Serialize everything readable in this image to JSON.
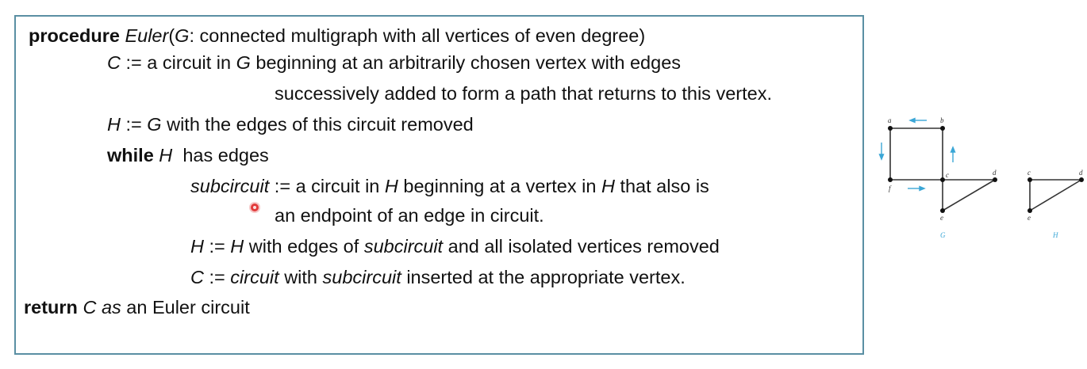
{
  "algorithm": {
    "lines": [
      {
        "segments": [
          {
            "t": "procedure ",
            "s": "b"
          },
          {
            "t": "Euler",
            "s": "i"
          },
          {
            "t": "(",
            "s": ""
          },
          {
            "t": "G",
            "s": "i"
          },
          {
            "t": ": connected multigraph with all vertices of even degree)",
            "s": ""
          }
        ]
      },
      {
        "segments": [
          {
            "t": "C",
            "s": "i"
          },
          {
            "t": " := a circuit in ",
            "s": ""
          },
          {
            "t": "G",
            "s": "i"
          },
          {
            "t": " beginning at an arbitrarily chosen vertex with edges",
            "s": ""
          }
        ]
      },
      {
        "segments": [
          {
            "t": "successively added to form a path that returns to this vertex.",
            "s": ""
          }
        ]
      },
      {
        "segments": [
          {
            "t": "H",
            "s": "i"
          },
          {
            "t": " := ",
            "s": ""
          },
          {
            "t": "G",
            "s": "i"
          },
          {
            "t": " with the edges of this circuit removed",
            "s": ""
          }
        ]
      },
      {
        "segments": [
          {
            "t": "while ",
            "s": "b"
          },
          {
            "t": "H",
            "s": "i"
          },
          {
            "t": "  has edges",
            "s": ""
          }
        ]
      },
      {
        "segments": [
          {
            "t": "subcircuit",
            "s": "i"
          },
          {
            "t": " := a circuit in ",
            "s": ""
          },
          {
            "t": "H",
            "s": "i"
          },
          {
            "t": " beginning at a vertex in ",
            "s": ""
          },
          {
            "t": "H",
            "s": "i"
          },
          {
            "t": " that also is",
            "s": ""
          }
        ]
      },
      {
        "segments": [
          {
            "t": "an endpoint of an edge in circuit.",
            "s": ""
          }
        ]
      },
      {
        "segments": [
          {
            "t": "H",
            "s": "i"
          },
          {
            "t": " := ",
            "s": ""
          },
          {
            "t": "H",
            "s": "i"
          },
          {
            "t": " with edges of ",
            "s": ""
          },
          {
            "t": "subcircuit",
            "s": "i"
          },
          {
            "t": " and all isolated vertices removed",
            "s": ""
          }
        ]
      },
      {
        "segments": [
          {
            "t": "C",
            "s": "i"
          },
          {
            "t": " := ",
            "s": ""
          },
          {
            "t": "circuit",
            "s": "i"
          },
          {
            "t": " with ",
            "s": ""
          },
          {
            "t": "subcircuit",
            "s": "i"
          },
          {
            "t": " inserted at the appropriate vertex.",
            "s": ""
          }
        ]
      },
      {
        "segments": [
          {
            "t": "return ",
            "s": "b"
          },
          {
            "t": "C as",
            "s": "i"
          },
          {
            "t": " an Euler circuit",
            "s": ""
          }
        ]
      }
    ]
  },
  "figure": {
    "graph_g": {
      "label": "G",
      "vertices": [
        "a",
        "b",
        "c",
        "d",
        "e",
        "f"
      ]
    },
    "graph_h": {
      "label": "H",
      "vertices": [
        "c",
        "d",
        "e"
      ]
    },
    "arrow_color": "#3aa6d6",
    "label_color": "#3aa6d6"
  }
}
